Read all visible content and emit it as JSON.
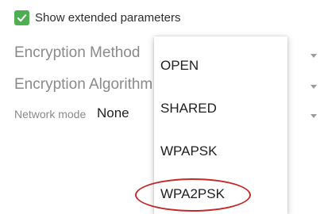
{
  "checkbox": {
    "label": "Show extended parameters",
    "checked": true,
    "color": "#4caf50"
  },
  "fields": [
    {
      "label": "Encryption Method"
    },
    {
      "label": "Encryption Algorithm"
    }
  ],
  "network_mode": {
    "label": "Network mode",
    "value": "None"
  },
  "dropdown": {
    "options": [
      "OPEN",
      "SHARED",
      "WPAPSK",
      "WPA2PSK"
    ],
    "highlighted_option": "WPA2PSK",
    "highlight_color": "#c42a2a"
  }
}
